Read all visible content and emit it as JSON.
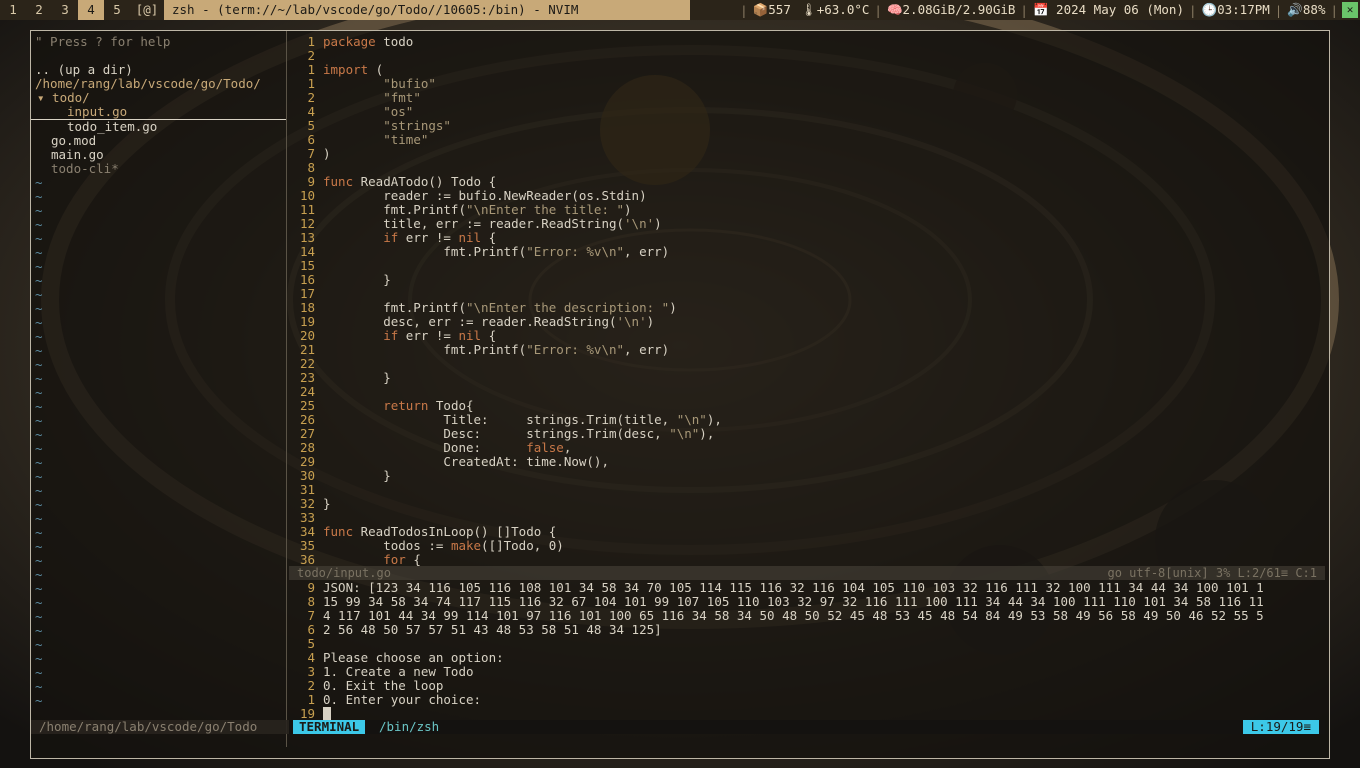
{
  "topbar": {
    "workspaces": [
      "1",
      "2",
      "3",
      "4",
      "5",
      "[@]"
    ],
    "active_workspace": "4",
    "window_title": "zsh - (term://~/lab/vscode/go/Todo//10605:/bin) - NVIM",
    "packages": "557",
    "temperature": "+63.0°C",
    "memory": "2.08GiB/2.90GiB",
    "date": "2024 May 06 (Mon)",
    "time": "03:17PM",
    "volume": "88%",
    "close_label": "✕"
  },
  "sidebar": {
    "help": "\" Press ? for help",
    "up_dir": ".. (up a dir)",
    "cwd": "/home/rang/lab/vscode/go/Todo/",
    "folder": "▾ todo/",
    "files": [
      "input.go",
      "todo_item.go"
    ],
    "root_files": [
      "go.mod",
      "main.go",
      "todo-cli*"
    ],
    "bottom_path": "/home/rang/lab/vscode/go/Todo"
  },
  "editor": {
    "lines": [
      {
        "n": "1",
        "c": "package todo"
      },
      {
        "n": "2",
        "c": ""
      },
      {
        "n": "1",
        "c": "import ("
      },
      {
        "n": "1",
        "c": "        \"bufio\""
      },
      {
        "n": "2",
        "c": "        \"fmt\""
      },
      {
        "n": "4",
        "c": "        \"os\""
      },
      {
        "n": "5",
        "c": "        \"strings\""
      },
      {
        "n": "6",
        "c": "        \"time\""
      },
      {
        "n": "7",
        "c": ")"
      },
      {
        "n": "8",
        "c": ""
      },
      {
        "n": "9",
        "c": "func ReadATodo() Todo {"
      },
      {
        "n": "10",
        "c": "        reader := bufio.NewReader(os.Stdin)"
      },
      {
        "n": "11",
        "c": "        fmt.Printf(\"\\nEnter the title: \")"
      },
      {
        "n": "12",
        "c": "        title, err := reader.ReadString('\\n')"
      },
      {
        "n": "13",
        "c": "        if err != nil {"
      },
      {
        "n": "14",
        "c": "                fmt.Printf(\"Error: %v\\n\", err)"
      },
      {
        "n": "15",
        "c": ""
      },
      {
        "n": "16",
        "c": "        }"
      },
      {
        "n": "17",
        "c": ""
      },
      {
        "n": "18",
        "c": "        fmt.Printf(\"\\nEnter the description: \")"
      },
      {
        "n": "19",
        "c": "        desc, err := reader.ReadString('\\n')"
      },
      {
        "n": "20",
        "c": "        if err != nil {"
      },
      {
        "n": "21",
        "c": "                fmt.Printf(\"Error: %v\\n\", err)"
      },
      {
        "n": "22",
        "c": ""
      },
      {
        "n": "23",
        "c": "        }"
      },
      {
        "n": "24",
        "c": ""
      },
      {
        "n": "25",
        "c": "        return Todo{"
      },
      {
        "n": "26",
        "c": "                Title:     strings.Trim(title, \"\\n\"),"
      },
      {
        "n": "27",
        "c": "                Desc:      strings.Trim(desc, \"\\n\"),"
      },
      {
        "n": "28",
        "c": "                Done:      false,"
      },
      {
        "n": "29",
        "c": "                CreatedAt: time.Now(),"
      },
      {
        "n": "30",
        "c": "        }"
      },
      {
        "n": "31",
        "c": ""
      },
      {
        "n": "32",
        "c": "}"
      },
      {
        "n": "33",
        "c": ""
      },
      {
        "n": "34",
        "c": "func ReadTodosInLoop() []Todo {"
      },
      {
        "n": "35",
        "c": "        todos := make([]Todo, 0)"
      },
      {
        "n": "36",
        "c": "        for {"
      }
    ],
    "status_left": "todo/input.go",
    "status_right": "go  utf-8[unix]  3% L:2/61≡ C:1"
  },
  "terminal": {
    "lines": [
      {
        "n": "9",
        "c": "JSON: [123 34 116 105 116 108 101 34 58 34 70 105 114 115 116 32 116 104 105 110 103 32 116 111 32 100 111 34 44 34 100 101 1"
      },
      {
        "n": "8",
        "c": "15 99 34 58 34 74 117 115 116 32 67 104 101 99 107 105 110 103 32 97 32 116 111 100 111 34 44 34 100 111 110 101 34 58 116 11"
      },
      {
        "n": "7",
        "c": "4 117 101 44 34 99 114 101 97 116 101 100 65 116 34 58 34 50 48 50 52 45 48 53 45 48 54 84 49 53 58 49 56 58 49 50 46 52 55 5"
      },
      {
        "n": "6",
        "c": "2 56 48 50 57 57 51 43 48 53 58 51 48 34 125]"
      },
      {
        "n": "5",
        "c": ""
      },
      {
        "n": "4",
        "c": "Please choose an option:"
      },
      {
        "n": "3",
        "c": "1. Create a new Todo"
      },
      {
        "n": "2",
        "c": "0. Exit the loop"
      },
      {
        "n": "1",
        "c": "0. Enter your choice:"
      },
      {
        "n": "19",
        "c": ""
      }
    ],
    "badge": "TERMINAL",
    "shell": "/bin/zsh",
    "position": "L:19/19≡"
  }
}
